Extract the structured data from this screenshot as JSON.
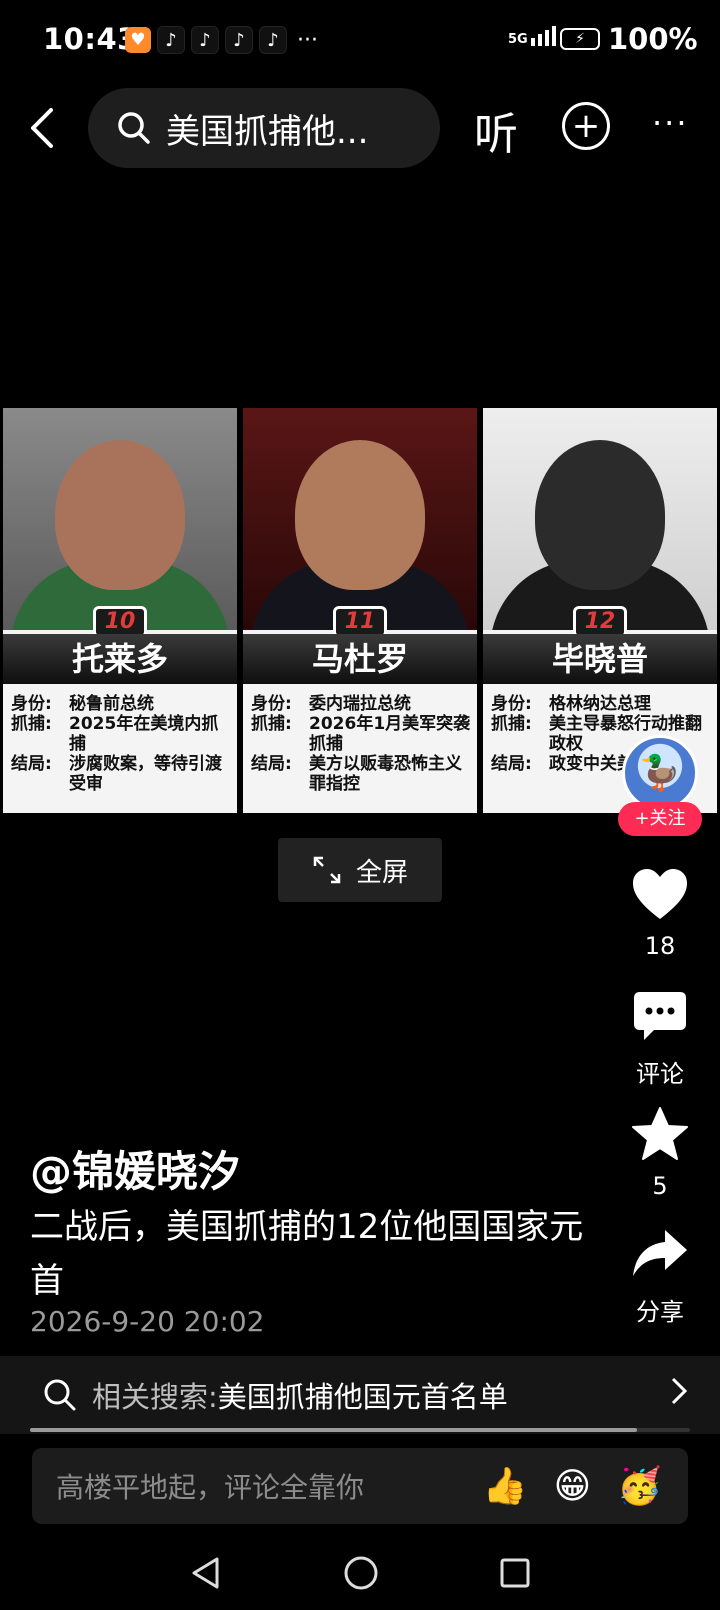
{
  "status_bar": {
    "time": "10:43",
    "network": "5G",
    "battery": "100%",
    "more": "···"
  },
  "top_bar": {
    "search_text": "美国抓捕他...",
    "listen_label": "听"
  },
  "cards": [
    {
      "number": "10",
      "name": "托莱多",
      "rows": [
        {
          "k": "身份:",
          "v": "秘鲁前总统"
        },
        {
          "k": "抓捕:",
          "v": "2025年在美境内抓捕"
        },
        {
          "k": "结局:",
          "v": "涉腐败案，等待引渡受审"
        }
      ]
    },
    {
      "number": "11",
      "name": "马杜罗",
      "rows": [
        {
          "k": "身份:",
          "v": "委内瑞拉总统"
        },
        {
          "k": "抓捕:",
          "v": "2026年1月美军突袭抓捕"
        },
        {
          "k": "结局:",
          "v": "美方以贩毒恐怖主义罪指控"
        }
      ]
    },
    {
      "number": "12",
      "name": "毕晓普",
      "rows": [
        {
          "k": "身份:",
          "v": "格林纳达总理"
        },
        {
          "k": "抓捕:",
          "v": "美主导暴怒行动推翻政权"
        },
        {
          "k": "结局:",
          "v": "政变中关美清算殒"
        }
      ]
    }
  ],
  "follow_label": "+关注",
  "fullscreen_label": "全屏",
  "actions": {
    "like_count": "18",
    "comment_label": "评论",
    "favorite_count": "5",
    "share_label": "分享"
  },
  "post": {
    "author": "@锦媛晓汐",
    "description": "二战后，美国抓捕的12位他国国家元首",
    "date": "2026-9-20 20:02"
  },
  "related_search": {
    "prefix": "相关搜索:",
    "query": "美国抓捕他国元首名单"
  },
  "progress": 0.92,
  "comment_input": {
    "placeholder": "高楼平地起，评论全靠你"
  },
  "colors": {
    "accent": "#fe2c55",
    "background": "#000000"
  }
}
